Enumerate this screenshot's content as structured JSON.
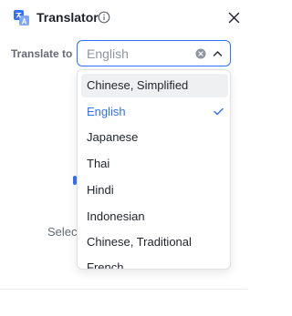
{
  "header": {
    "title": "Translator",
    "app_icon": "translate-icon",
    "info_icon": "info-icon",
    "close_icon": "close-icon"
  },
  "translate_to": {
    "label": "Translate to",
    "value": "English",
    "clear_icon": "clear-circle-icon",
    "chevron_icon": "chevron-up-icon"
  },
  "dropdown": {
    "options": [
      {
        "label": "Chinese, Simplified",
        "state": "hovered"
      },
      {
        "label": "English",
        "state": "selected"
      },
      {
        "label": "Japanese",
        "state": "normal"
      },
      {
        "label": "Thai",
        "state": "normal"
      },
      {
        "label": "Hindi",
        "state": "normal"
      },
      {
        "label": "Indonesian",
        "state": "normal"
      },
      {
        "label": "Chinese, Traditional",
        "state": "normal"
      },
      {
        "label": "French",
        "state": "normal"
      }
    ],
    "check_icon": "check-icon"
  },
  "background": {
    "hint_text": "Select"
  },
  "colors": {
    "accent": "#3370ff",
    "text": "#1f2329",
    "muted": "#646a73",
    "placeholder": "#8f959e",
    "hover_bg": "#eff0f1",
    "border": "#dee0e3"
  }
}
